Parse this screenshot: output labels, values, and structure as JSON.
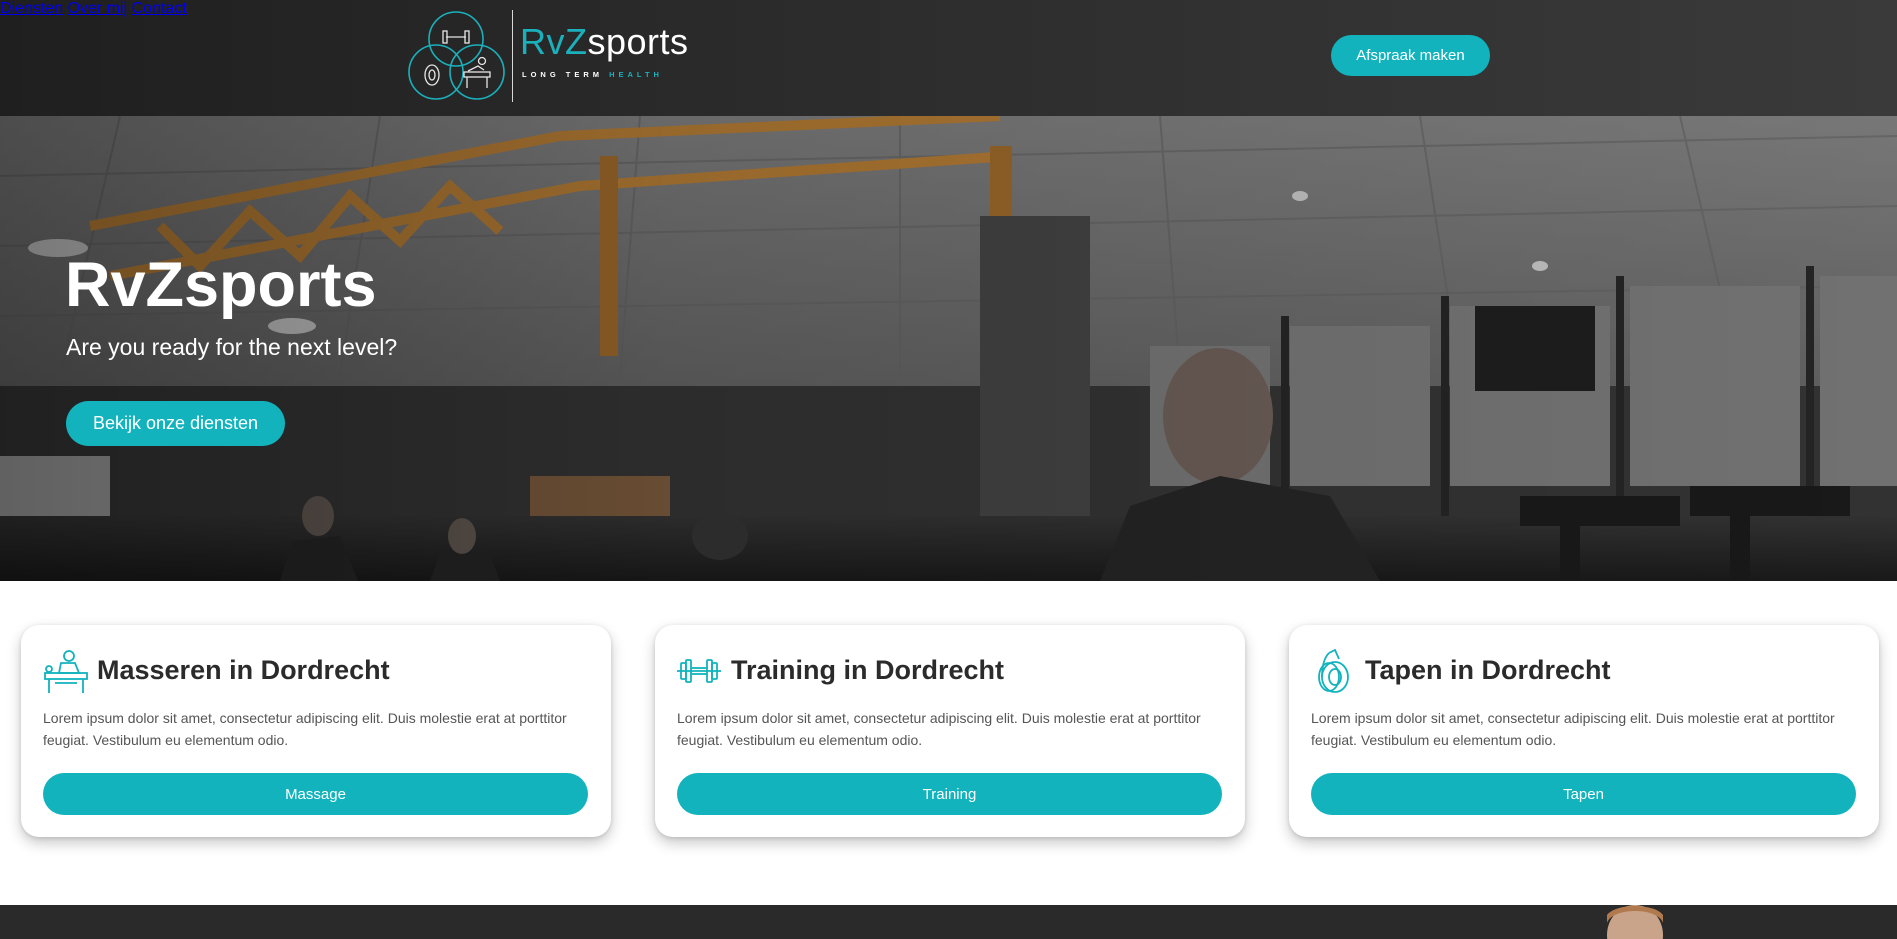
{
  "brand": {
    "name_accent": "RvZ",
    "name_rest": "sports",
    "tagline_start": "LONG TERM ",
    "tagline_accent": "HEALTH",
    "accent_color": "#12b3bd"
  },
  "nav": {
    "items": [
      {
        "label": "Diensten"
      },
      {
        "label": "Over mij"
      },
      {
        "label": "Contact"
      }
    ],
    "cta_label": "Afspraak maken"
  },
  "hero": {
    "title": "RvZsports",
    "subtitle": "Are you ready for the next level?",
    "cta_label": "Bekijk onze diensten"
  },
  "cards": [
    {
      "icon": "massage-icon",
      "title": "Masseren in Dordrecht",
      "text": "Lorem ipsum dolor sit amet, consectetur adipiscing elit. Duis molestie erat at porttitor feugiat. Vestibulum eu elementum odio.",
      "button_label": "Massage"
    },
    {
      "icon": "dumbbell-icon",
      "title": "Training in Dordrecht",
      "text": "Lorem ipsum dolor sit amet, consectetur adipiscing elit. Duis molestie erat at porttitor feugiat. Vestibulum eu elementum odio.",
      "button_label": "Training"
    },
    {
      "icon": "tape-roll-icon",
      "title": "Tapen in Dordrecht",
      "text": "Lorem ipsum dolor sit amet, consectetur adipiscing elit. Duis molestie erat at porttitor feugiat. Vestibulum eu elementum odio.",
      "button_label": "Tapen"
    }
  ]
}
